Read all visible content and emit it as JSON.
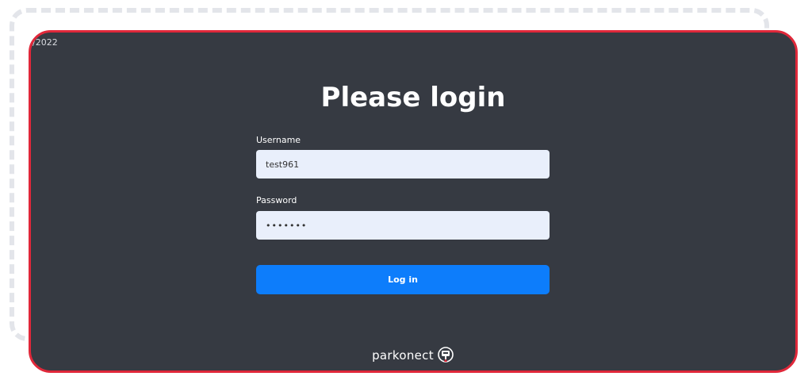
{
  "header": {
    "date_fragment": "/2022"
  },
  "login": {
    "title": "Please login",
    "username_label": "Username",
    "username_value": "test961",
    "password_label": "Password",
    "password_value": "•••••••",
    "submit_label": "Log in"
  },
  "footer": {
    "brand_name": "parkonect",
    "brand_icon": "parking-meter-icon"
  },
  "colors": {
    "panel_bg": "#363a42",
    "panel_border": "#e0283a",
    "button_bg": "#0d7dfb",
    "field_bg": "#e9effb"
  }
}
